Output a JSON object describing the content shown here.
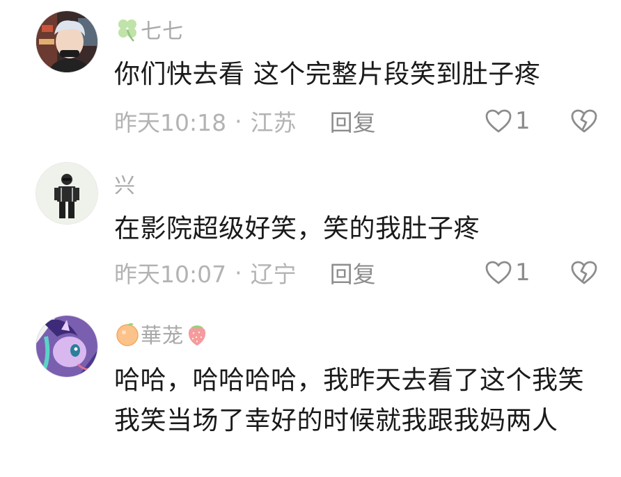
{
  "comments": [
    {
      "username": "七七",
      "text": "你们快去看 这个完整片段笑到肚子疼",
      "time": "昨天10:18",
      "separator": "·",
      "location": "江苏",
      "reply_label": "回复",
      "likes": "1",
      "prefix_icon": "four-leaf-clover-icon"
    },
    {
      "username": "兴",
      "text": "在影院超级好笑，笑的我肚子疼",
      "time": "昨天10:07",
      "separator": "·",
      "location": "辽宁",
      "reply_label": "回复",
      "likes": "1"
    },
    {
      "username": "華茏",
      "text": "哈哈，哈哈哈哈，我昨天去看了这个我笑我笑当场了幸好的时候就我跟我妈两人",
      "prefix_icon": "orange-fruit-icon",
      "suffix_icon": "strawberry-icon"
    }
  ],
  "colors": {
    "text": "#1a1a1a",
    "muted": "#b3b3b3",
    "username": "#a9a9a9",
    "icon": "#8c8c8c"
  }
}
